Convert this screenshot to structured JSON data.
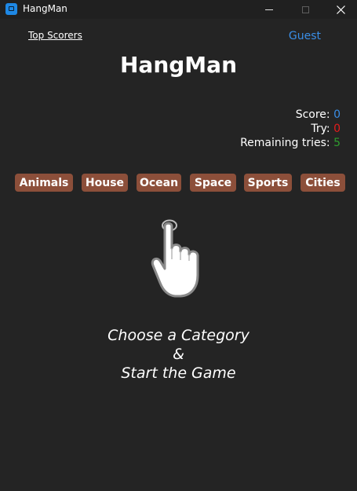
{
  "window": {
    "title": "HangMan",
    "icon": "app-icon",
    "controls": [
      "minimize-icon",
      "maximize-icon",
      "close-icon"
    ]
  },
  "nav": {
    "top_scorers": "Top Scorers",
    "user": "Guest"
  },
  "header": {
    "title": "HangMan"
  },
  "stats": {
    "score_label": "Score:",
    "score_value": "0",
    "try_label": "Try:",
    "try_value": "0",
    "remaining_label": "Remaining tries:",
    "remaining_value": "5"
  },
  "categories": [
    "Animals",
    "House",
    "Ocean",
    "Space",
    "Sports",
    "Cities"
  ],
  "main": {
    "icon": "pointing-hand-icon",
    "prompt_line1": "Choose a Category",
    "prompt_line2": "&",
    "prompt_line3": "Start the Game"
  },
  "colors": {
    "background": "#242424",
    "category_button": "#8c4f3a",
    "score": "#3a8ee6",
    "try": "#e51c1c",
    "remaining": "#2e9e2e",
    "guest_link": "#3a8ee6"
  }
}
